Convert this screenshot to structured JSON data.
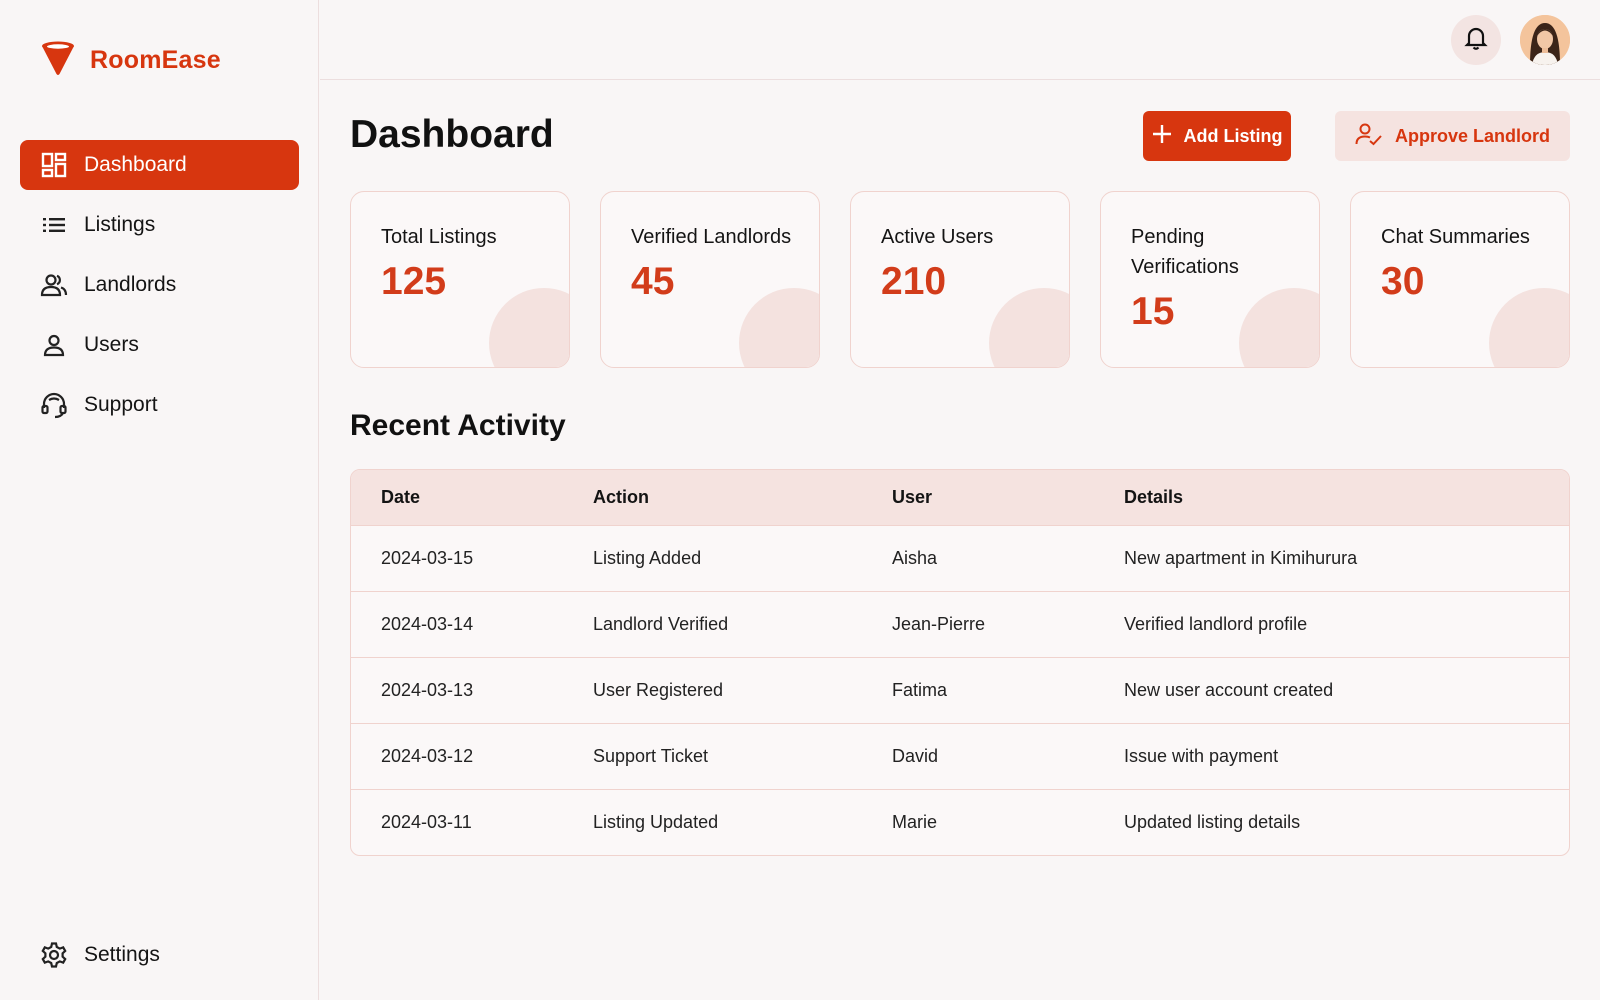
{
  "brand": {
    "name": "RoomEase"
  },
  "sidebar": {
    "items": [
      {
        "label": "Dashboard",
        "icon": "dashboard-icon",
        "active": true
      },
      {
        "label": "Listings",
        "icon": "list-icon"
      },
      {
        "label": "Landlords",
        "icon": "users-icon"
      },
      {
        "label": "Users",
        "icon": "user-icon"
      },
      {
        "label": "Support",
        "icon": "headset-icon"
      }
    ],
    "settings": {
      "label": "Settings",
      "icon": "gear-icon"
    }
  },
  "header": {
    "title": "Dashboard",
    "add_listing_label": "Add Listing",
    "approve_landlord_label": "Approve Landlord"
  },
  "stats": [
    {
      "label": "Total Listings",
      "value": "125"
    },
    {
      "label": "Verified Landlords",
      "value": "45"
    },
    {
      "label": "Active Users",
      "value": "210"
    },
    {
      "label": "Pending Verifications",
      "value": "15"
    },
    {
      "label": "Chat Summaries",
      "value": "30"
    }
  ],
  "recent_activity": {
    "title": "Recent Activity",
    "columns": [
      "Date",
      "Action",
      "User",
      "Details"
    ],
    "rows": [
      {
        "date": "2024-03-15",
        "action": "Listing Added",
        "user": "Aisha",
        "details": "New apartment in Kimihurura"
      },
      {
        "date": "2024-03-14",
        "action": "Landlord Verified",
        "user": "Jean-Pierre",
        "details": "Verified landlord profile"
      },
      {
        "date": "2024-03-13",
        "action": "User Registered",
        "user": "Fatima",
        "details": "New user account created"
      },
      {
        "date": "2024-03-12",
        "action": "Support Ticket",
        "user": "David",
        "details": "Issue with payment"
      },
      {
        "date": "2024-03-11",
        "action": "Listing Updated",
        "user": "Marie",
        "details": "Updated listing details"
      }
    ]
  },
  "colors": {
    "accent": "#d7360f",
    "accent_soft": "#f5e3e0",
    "background": "#f9f6f6",
    "border": "#f0d3ce"
  }
}
